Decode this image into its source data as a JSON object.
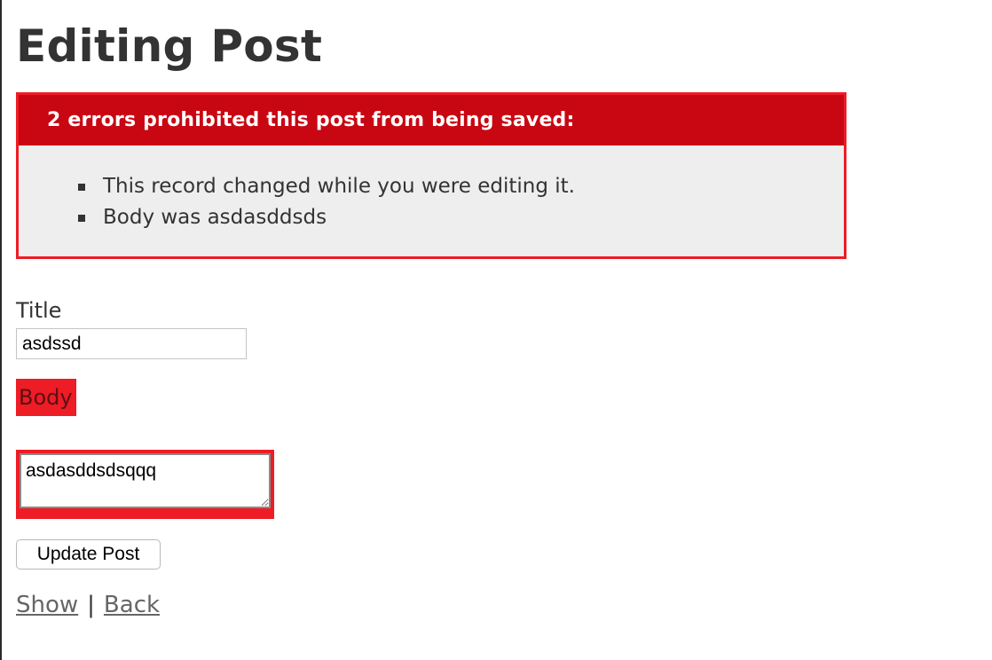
{
  "page": {
    "heading": "Editing Post"
  },
  "errors": {
    "header": "2 errors prohibited this post from being saved:",
    "items": [
      "This record changed while you were editing it.",
      "Body was asdasddsds"
    ],
    "colors": {
      "border": "#ee1c25",
      "header_bg": "#c80713"
    }
  },
  "form": {
    "title_label": "Title",
    "title_value": "asdssd",
    "body_label": "Body",
    "body_value": "asdasddsdsqqq",
    "submit_label": "Update Post"
  },
  "links": {
    "show": "Show",
    "separator": "|",
    "back": "Back"
  }
}
